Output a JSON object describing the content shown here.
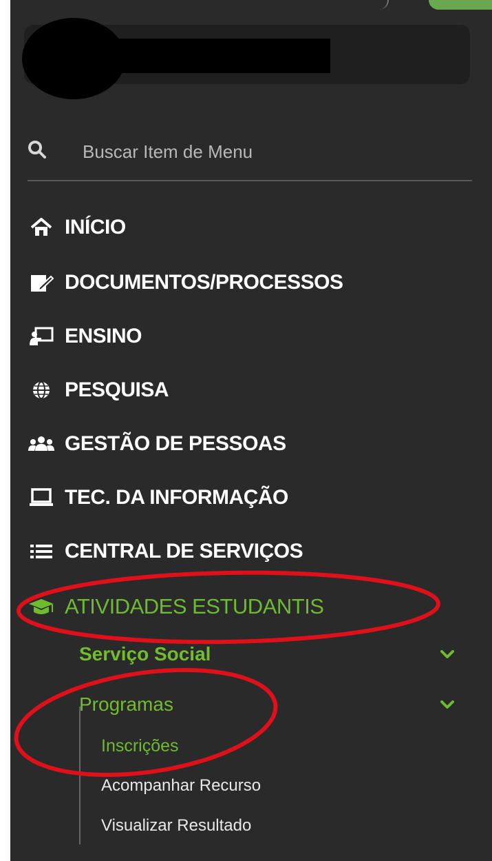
{
  "search": {
    "placeholder": "Buscar Item de Menu"
  },
  "menu": {
    "items": [
      {
        "label": "INÍCIO",
        "icon": "home-icon"
      },
      {
        "label": "DOCUMENTOS/PROCESSOS",
        "icon": "document-edit-icon"
      },
      {
        "label": "ENSINO",
        "icon": "teacher-board-icon"
      },
      {
        "label": "PESQUISA",
        "icon": "globe-icon"
      },
      {
        "label": "GESTÃO DE PESSOAS",
        "icon": "users-icon"
      },
      {
        "label": "TEC. DA INFORMAÇÃO",
        "icon": "laptop-icon"
      },
      {
        "label": "CENTRAL DE SERVIÇOS",
        "icon": "list-icon"
      },
      {
        "label": "ATIVIDADES ESTUDANTIS",
        "icon": "graduation-cap-icon",
        "active": true
      }
    ]
  },
  "submenu": {
    "groups": [
      {
        "label": "Serviço Social",
        "expanded": false
      },
      {
        "label": "Programas",
        "expanded": true
      }
    ],
    "programas_items": [
      {
        "label": "Inscrições",
        "selected": true
      },
      {
        "label": "Acompanhar Recurso"
      },
      {
        "label": "Visualizar Resultado"
      }
    ]
  },
  "colors": {
    "sidebar_bg": "#2a2a2a",
    "accent_green": "#6dbb2e",
    "annotation_red": "#e0101a"
  }
}
